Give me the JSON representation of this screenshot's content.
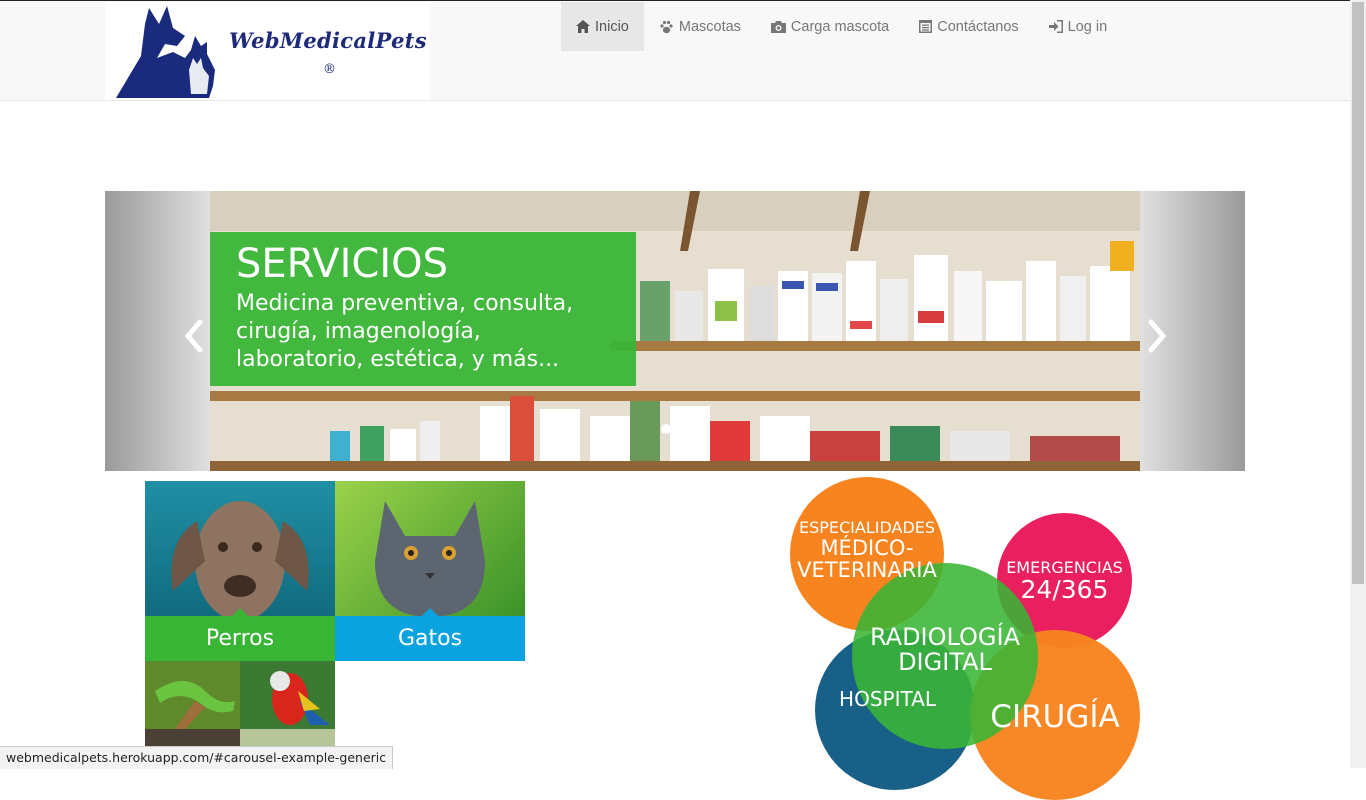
{
  "brand": {
    "name": "WebMedicalPets",
    "reg": "®"
  },
  "nav": [
    {
      "icon": "home-icon",
      "label": "Inicio",
      "active": true
    },
    {
      "icon": "paw-icon",
      "label": "Mascotas"
    },
    {
      "icon": "camera-icon",
      "label": "Carga mascota"
    },
    {
      "icon": "list-icon",
      "label": "Contáctanos"
    },
    {
      "icon": "login-icon",
      "label": "Log in"
    }
  ],
  "carousel": {
    "title": "SERVICIOS",
    "text": "Medicina preventiva, consulta, cirugía, imagenología, laboratorio, estética, y más...",
    "slides": 2,
    "active": 0
  },
  "tiles": {
    "perros": "Perros",
    "gatos": "Gatos"
  },
  "bubbles": {
    "especialidades_1": "ESPECIALIDADES",
    "especialidades_2": "MÉDICO-",
    "especialidades_3": "VETERINARIA",
    "emergencias_1": "EMERGENCIAS",
    "emergencias_2": "24/365",
    "radiologia_1": "RADIOLOGÍA",
    "radiologia_2": "DIGITAL",
    "hospital": "HOSPITAL",
    "cirugia": "CIRUGÍA"
  },
  "colors": {
    "green": "#39b536",
    "blue": "#0aa3e0",
    "orange": "#f7841e",
    "pink": "#ea1f5f",
    "navy": "#0d5783"
  },
  "status_url": "webmedicalpets.herokuapp.com/#carousel-example-generic"
}
